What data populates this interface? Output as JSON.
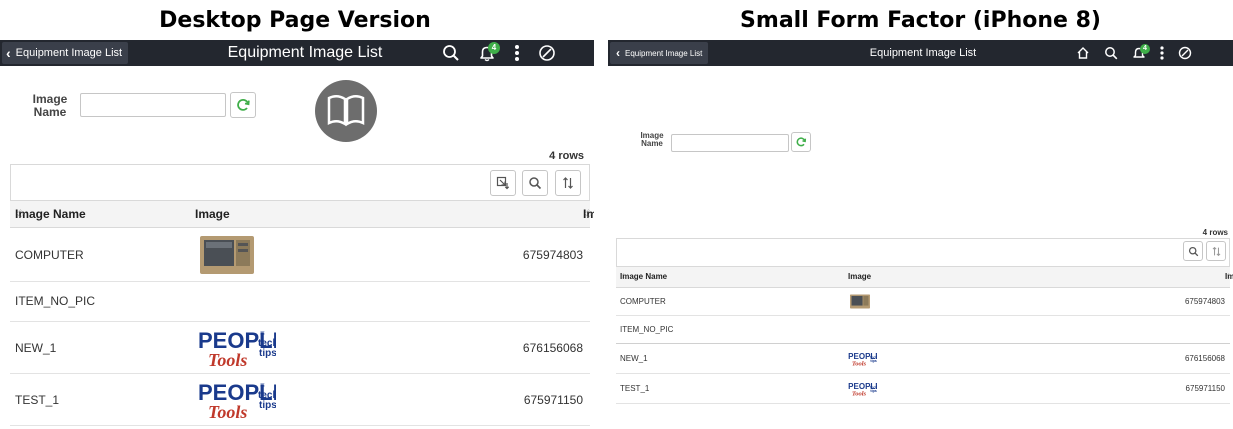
{
  "captions": {
    "desktop": "Desktop Page Version",
    "mobile": "Small Form Factor (iPhone 8)"
  },
  "nav": {
    "back_label": "Equipment Image List",
    "title": "Equipment Image List",
    "notification_count": "4",
    "icons": [
      "home-icon",
      "search-icon",
      "notification-icon",
      "actions-menu-icon",
      "navbar-icon"
    ]
  },
  "search": {
    "label_line1": "Image",
    "label_line2": "Name",
    "value": ""
  },
  "grid": {
    "row_count": "4 rows",
    "columns": [
      "Image Name",
      "Image",
      "Image Version"
    ],
    "rows": [
      {
        "name": "COMPUTER",
        "image": "computer-photo",
        "version": "675974803"
      },
      {
        "name": "ITEM_NO_PIC",
        "image": "",
        "version": ""
      },
      {
        "name": "NEW_1",
        "image": "peopletools-tech-tips-logo",
        "version": "676156068"
      },
      {
        "name": "TEST_1",
        "image": "peopletools-tech-tips-logo",
        "version": "675971150"
      }
    ]
  },
  "colors": {
    "header_bar": "#23272f",
    "badge": "#3fae49",
    "refresh_icon": "#3fae49",
    "logo_blue": "#1a3a8c",
    "logo_red": "#c0392b"
  }
}
